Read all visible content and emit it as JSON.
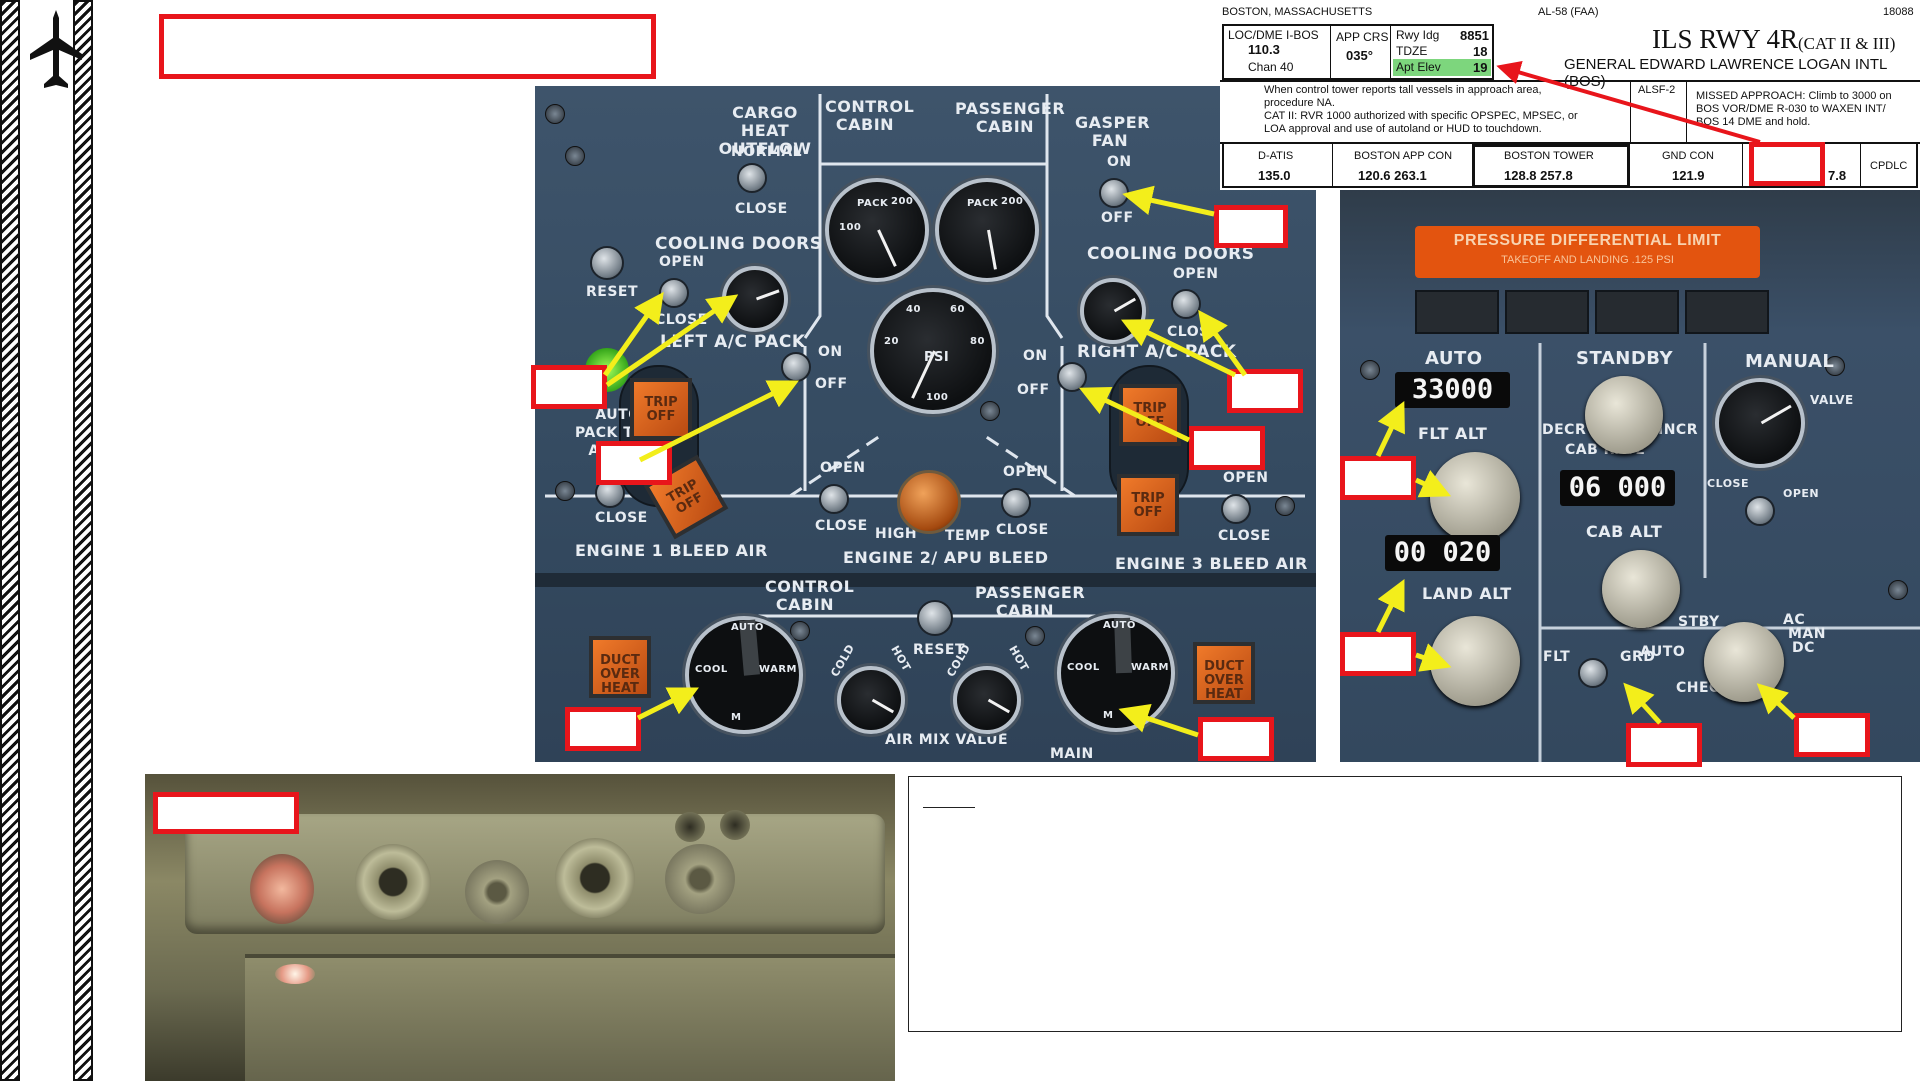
{
  "sidebar": {
    "icon": "airplane-icon"
  },
  "colors": {
    "accent_red": "#e8151b",
    "arrow_yellow": "#f3ee1b",
    "panel_blue": "#3a4f66",
    "tower_green": "#7dd67d"
  },
  "aircon_panel": {
    "cargo_heat_outflow": "CARGO HEAT OUTFLOW",
    "normal": "NORMAL",
    "close": "CLOSE",
    "control_cabin": "CONTROL CABIN",
    "passenger_cabin": "PASSENGER CABIN",
    "gasper_fan": "GASPER FAN",
    "on": "ON",
    "off": "OFF",
    "cooling_doors": "COOLING DOORS",
    "open": "OPEN",
    "closed": "CLOSED",
    "reset": "RESET",
    "left_ac_pack": "LEFT A/C PACK",
    "right_ac_pack": "RIGHT A/C PACK",
    "auto_pack_trip_armed": "AUTO PACK TRIP ARMED",
    "trip_off": "TRIP OFF",
    "pack": "PACK",
    "gauge_200": "200",
    "gauge_100": "100",
    "psi": "PSI",
    "g_40": "40",
    "g_60": "60",
    "g_20": "20",
    "g_80": "80",
    "g_100": "100",
    "high": "HIGH",
    "temp": "TEMP",
    "engine1_bleed": "ENGINE 1 BLEED AIR",
    "engine2_bleed": "ENGINE 2/ APU BLEED",
    "engine3_bleed": "ENGINE 3 BLEED AIR",
    "duct_overheat": "DUCT OVER HEAT",
    "auto": "AUTO",
    "cool": "COOL",
    "warm": "WARM",
    "m": "M",
    "cold": "COLD",
    "hot": "HOT",
    "air_mix_value": "AIR MIX VALUE",
    "main": "MAIN"
  },
  "pressure_panel": {
    "pressure_limit_title": "PRESSURE DIFFERENTIAL LIMIT",
    "pressure_limit_sub": "TAKEOFF AND LANDING .125 PSI",
    "auto": "AUTO",
    "standby": "STANDBY",
    "manual": "MANUAL",
    "flt_alt_value": "33000",
    "flt_alt": "FLT ALT",
    "decr": "DECR",
    "incr": "INCR",
    "cab_rate": "CAB RATE",
    "cab_alt_value": "06 000",
    "cab_alt": "CAB ALT",
    "land_alt_value": "00 020",
    "land_alt": "LAND ALT",
    "valve": "VALVE",
    "close": "CLOSE",
    "open": "OPEN",
    "flt": "FLT",
    "grd": "GRD",
    "stby": "STBY",
    "auto_sel": "AUTO",
    "ac": "AC",
    "man": "MAN",
    "dc": "DC",
    "check": "CHECK"
  },
  "chart": {
    "location": "BOSTON, MASSACHUSETTS",
    "faa_ref": "AL-58 (FAA)",
    "number": "18088",
    "title": "ILS RWY 4R",
    "cat": "(CAT II & III)",
    "airport": "GENERAL EDWARD LAWRENCE LOGAN INTL (BOS)",
    "loc_label": "LOC/DME I-BOS",
    "loc_freq": "110.3",
    "chan": "Chan 40",
    "app_crs_label": "APP CRS",
    "app_crs": "035°",
    "rwy_ldg_label": "Rwy Idg",
    "rwy_ldg": "8851",
    "tdze_label": "TDZE",
    "tdze": "18",
    "apt_elev_label": "Apt Elev",
    "apt_elev": "19",
    "notes_1": "When control tower reports tall vessels in approach area, procedure NA.",
    "notes_2": "CAT II: RVR 1000 authorized with specific OPSPEC, MPSEC, or LOA approval and use of autoland or HUD to touchdown.",
    "alsf": "ALSF-2",
    "missed": "MISSED APPROACH: Climb to 3000 on BOS VOR/DME R-030 to WAXEN INT/ BOS 14 DME and hold.",
    "datis_label": "D-ATIS",
    "datis": "135.0",
    "app_con_label": "BOSTON APP CON",
    "app_con": "120.6  263.1",
    "tower_label": "BOSTON TOWER",
    "tower": "128.8  257.8",
    "gnd_con_label": "GND CON",
    "gnd_con": "121.9",
    "partial": "7.8",
    "cpdlc": "CPDLC"
  }
}
